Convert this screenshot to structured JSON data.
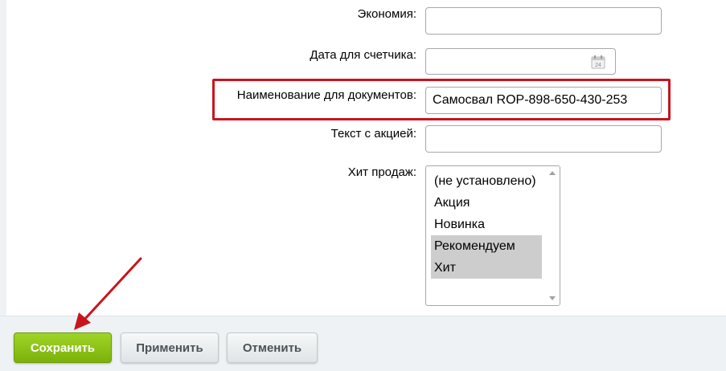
{
  "form": {
    "economy": {
      "label": "Экономия:",
      "value": ""
    },
    "counter_date": {
      "label": "Дата для счетчика:",
      "value": "",
      "icon": "calendar-icon",
      "icon_text": "24"
    },
    "doc_name": {
      "label": "Наименование для документов:",
      "value": "Самосвал ROP-898-650-430-253"
    },
    "promo_text": {
      "label": "Текст с акцией:",
      "value": ""
    },
    "bestseller": {
      "label": "Хит продаж:",
      "options": [
        {
          "label": "(не установлено)",
          "selected": false
        },
        {
          "label": "Акция",
          "selected": false
        },
        {
          "label": "Новинка",
          "selected": false
        },
        {
          "label": "Рекомендуем",
          "selected": true
        },
        {
          "label": "Хит",
          "selected": true
        }
      ]
    }
  },
  "footer": {
    "save_label": "Сохранить",
    "apply_label": "Применить",
    "cancel_label": "Отменить"
  },
  "colors": {
    "highlight": "#c8151d",
    "save_button": "#8cc21a",
    "annotation_arrow": "#c8151d"
  }
}
